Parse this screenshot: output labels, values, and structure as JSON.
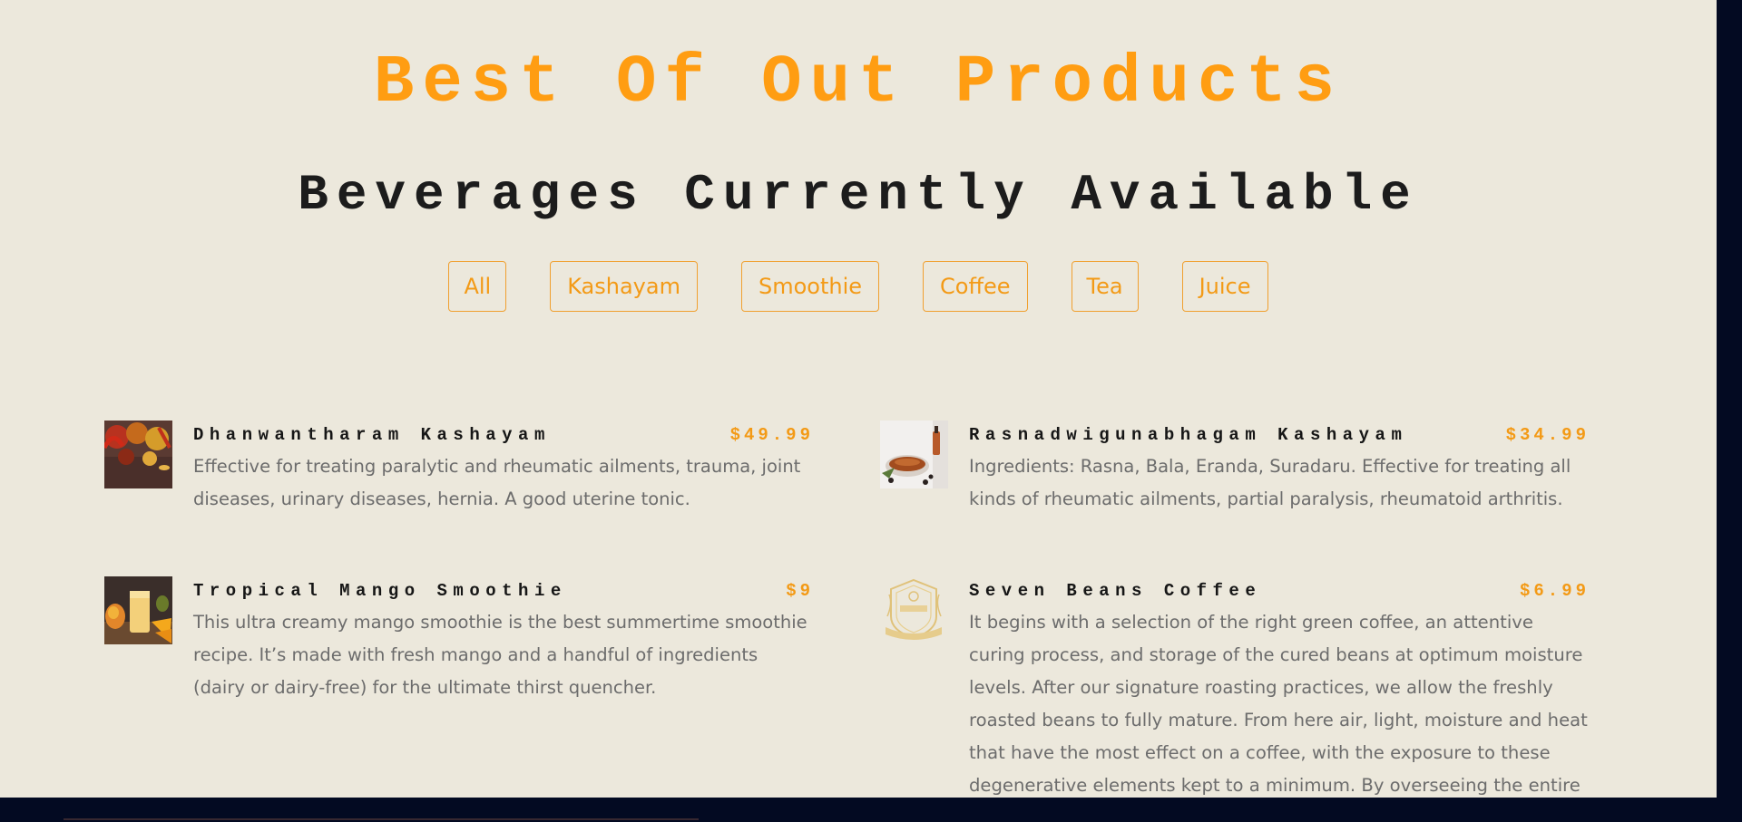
{
  "header": {
    "title": "Best Of Out Products",
    "subtitle": "Beverages Currently Available"
  },
  "filters": [
    "All",
    "Kashayam",
    "Smoothie",
    "Coffee",
    "Tea",
    "Juice"
  ],
  "products": [
    {
      "name": "Dhanwantharam Kashayam",
      "price": "$49.99",
      "description": "Effective for treating paralytic and rheumatic ailments, trauma, joint diseases, urinary diseases, hernia. A good uterine tonic.",
      "image_icon": "spices-photo"
    },
    {
      "name": "Rasnadwigunabhagam Kashayam",
      "price": "$34.99",
      "description": "Ingredients: Rasna, Bala, Eranda, Suradaru. Effective for treating all kinds of rheumatic ailments, partial paralysis, rheumatoid arthritis.",
      "image_icon": "herbal-tea-photo"
    },
    {
      "name": "Tropical Mango Smoothie",
      "price": "$9",
      "description": "This ultra creamy mango smoothie is the best summertime smoothie recipe. It’s made with fresh mango and a handful of ingredients (dairy or dairy-free) for the ultimate thirst quencher.",
      "image_icon": "mango-smoothie-photo"
    },
    {
      "name": "Seven Beans Coffee",
      "price": "$6.99",
      "description": "It begins with a selection of the right green coffee, an attentive curing process, and storage of the cured beans at optimum moisture levels. After our signature roasting practices, we allow the freshly roasted beans to fully mature. From here air, light, moisture and heat that have the most effect on a coffee, with the exposure to these degenerative elements kept to a minimum. By overseeing the entire",
      "image_icon": "coffee-company-logo"
    }
  ],
  "colors": {
    "accent": "#ff9d12",
    "page_background": "#ece8dc",
    "frame": "#030a22",
    "text_muted": "#6c6c6c"
  }
}
